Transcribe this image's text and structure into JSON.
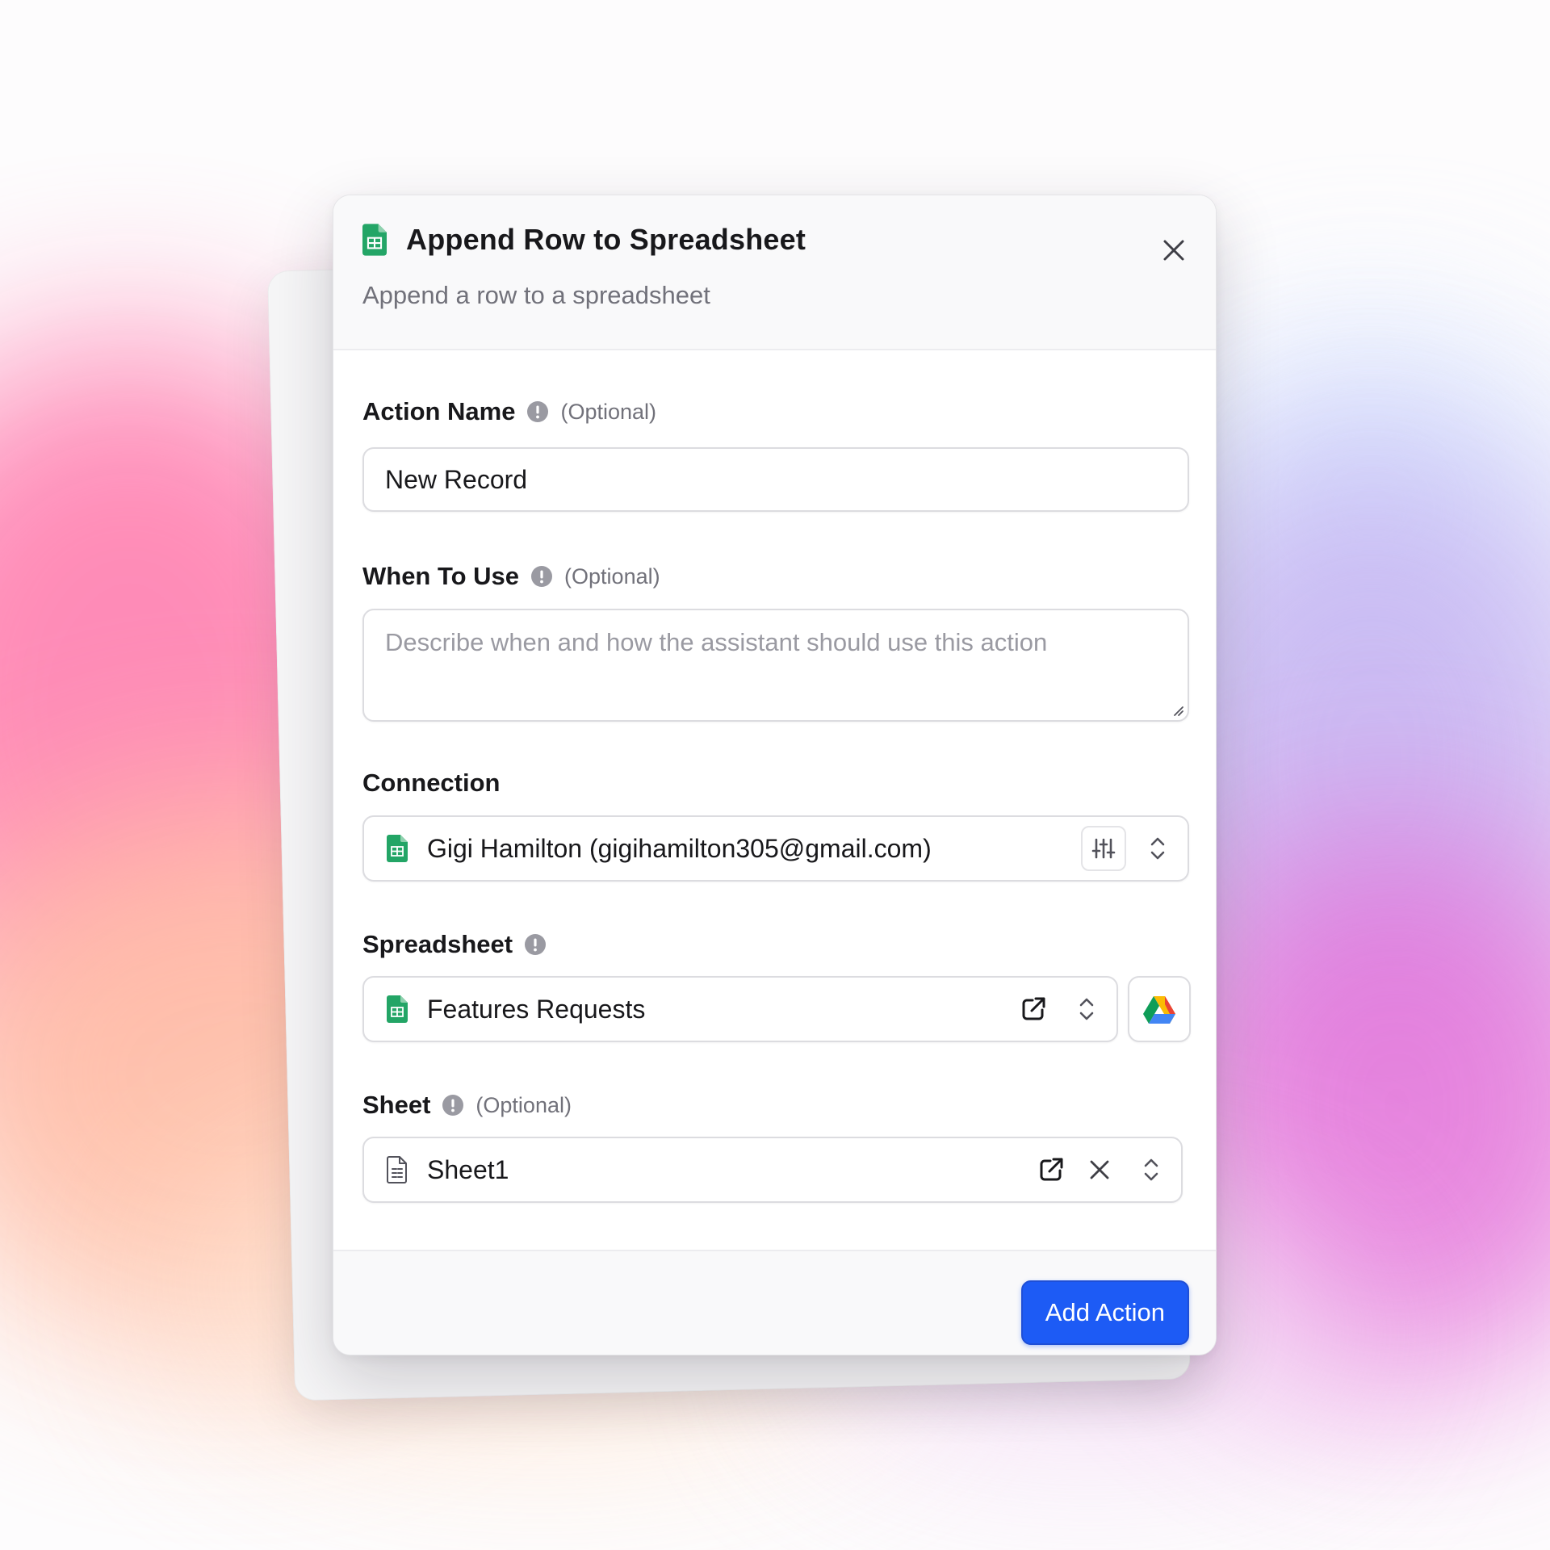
{
  "dialog": {
    "title": "Append Row to Spreadsheet",
    "subtitle": "Append a row to a spreadsheet",
    "close_icon": "close-icon",
    "header_icon": "google-sheets-icon"
  },
  "fields": {
    "action_name": {
      "label": "Action Name",
      "optional": "(Optional)",
      "value": "New Record"
    },
    "when_to_use": {
      "label": "When To Use",
      "optional": "(Optional)",
      "placeholder": "Describe when and how the assistant should use this action"
    },
    "connection": {
      "label": "Connection",
      "value": "Gigi Hamilton (gigihamilton305@gmail.com)"
    },
    "spreadsheet": {
      "label": "Spreadsheet",
      "value": "Features Requests"
    },
    "sheet": {
      "label": "Sheet",
      "optional": "(Optional)",
      "value": "Sheet1"
    }
  },
  "footer": {
    "submit_label": "Add Action"
  },
  "colors": {
    "accent": "#1d5bf5",
    "sheets_green": "#23a566"
  }
}
